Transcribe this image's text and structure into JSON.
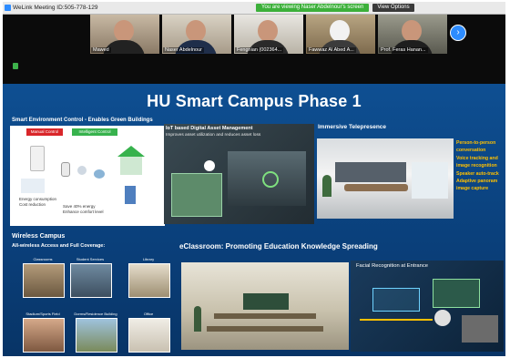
{
  "window": {
    "meeting_title": "WeLink Meeting ID:505-778-129",
    "viewing_banner": "You are viewing Naser Abdelnour's screen",
    "view_options": "View Options",
    "next_page": "›"
  },
  "participants": [
    {
      "name": "Mawed"
    },
    {
      "name": "Naser Abdelnour"
    },
    {
      "name": "Fengnian (002364..."
    },
    {
      "name": "Fawwaz Al Abed A..."
    },
    {
      "name": "Prof. Feras Hanan..."
    }
  ],
  "slide": {
    "title": "HU Smart Campus Phase 1",
    "env": {
      "title": "Smart Environment Control - Enables Green Buildings",
      "manual": "Manual Control",
      "intelligent": "Intelligent Control",
      "notes": [
        "Energy consumption",
        "Cost reduction",
        "Save 40% energy",
        "Enhance comfort level"
      ]
    },
    "iot": {
      "title": "IoT based Digital Asset Management",
      "subtitle": "Improves asset utilization and reduces asset loss"
    },
    "telepresence": {
      "title": "Immersive Telepresence"
    },
    "features": [
      "Person-to-person",
      "conversation",
      "Voice tracking and",
      "image recognition",
      "Speaker auto-track",
      "Adaptive panoram",
      "image capture"
    ],
    "wireless": {
      "title": "Wireless Campus",
      "subtitle": "All-wireless Access and Full Coverage:",
      "items": [
        "Classrooms",
        "Student Services",
        "Library",
        "Stadium/Sports Field",
        "Dorms/Residence Building",
        "Office"
      ]
    },
    "eclassroom": {
      "title": "eClassroom: Promoting Education Knowledge Spreading"
    },
    "facial": {
      "title": "Facial Recognition at Entrance"
    }
  },
  "colors": {
    "slide_bg": "#0e4f92",
    "accent_gold": "#ffc000",
    "banner_green": "#3cb03a",
    "manual_red": "#d9262a",
    "intelligent_green": "#37b24d"
  }
}
